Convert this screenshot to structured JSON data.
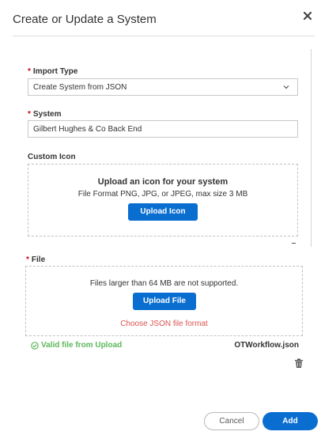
{
  "dialog": {
    "title": "Create or Update a System",
    "close_icon": "close-icon"
  },
  "import_type": {
    "required_mark": "*",
    "label": "Import Type",
    "value": "Create System from JSON",
    "chevron_icon": "chevron-down-icon"
  },
  "system": {
    "required_mark": "*",
    "label": "System",
    "value": "Gilbert Hughes & Co Back End"
  },
  "custom_icon": {
    "label": "Custom Icon",
    "title": "Upload an icon for your system",
    "subtitle": "File Format PNG, JPG, or JPEG, max size 3 MB",
    "button_label": "Upload Icon"
  },
  "file": {
    "required_mark": "*",
    "label": "File",
    "note": "Files larger than 64 MB are not supported.",
    "button_label": "Upload File",
    "error": "Choose JSON file format",
    "valid_text": "Valid file from Upload",
    "valid_icon": "check-circle-icon",
    "filename": "OTWorkflow.json",
    "delete_icon": "trash-icon"
  },
  "footer": {
    "cancel_label": "Cancel",
    "add_label": "Add"
  },
  "colors": {
    "primary": "#0a6ed1",
    "required": "#d0021b",
    "success": "#5cb85c",
    "error": "#d9534f"
  }
}
